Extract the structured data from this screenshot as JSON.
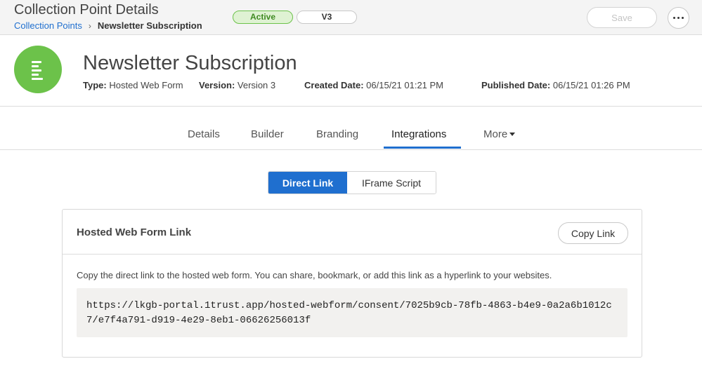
{
  "header": {
    "title": "Collection Point Details",
    "breadcrumb": {
      "link": "Collection Points",
      "current": "Newsletter Subscription"
    },
    "status_badge": "Active",
    "version_badge": "V3",
    "save_label": "Save"
  },
  "colors": {
    "accent": "#1f6fcf",
    "status_green": "#6cc24a",
    "logo_bg": "#6cc24a"
  },
  "collection_point": {
    "icon": "form-list-icon",
    "name": "Newsletter Subscription",
    "type_label": "Type:",
    "type_value": "Hosted Web Form",
    "version_label": "Version:",
    "version_value": "Version 3",
    "created_label": "Created Date:",
    "created_value": "06/15/21 01:21 PM",
    "published_label": "Published Date:",
    "published_value": "06/15/21 01:26 PM"
  },
  "tabs": [
    {
      "label": "Details"
    },
    {
      "label": "Builder"
    },
    {
      "label": "Branding"
    },
    {
      "label": "Integrations",
      "active": true
    },
    {
      "label": "More"
    }
  ],
  "integration_mode": {
    "options": [
      "Direct Link",
      "IFrame Script"
    ],
    "selected": "Direct Link"
  },
  "card": {
    "title": "Hosted Web Form Link",
    "copy_label": "Copy Link",
    "description": "Copy the direct link to the hosted web form. You can share, bookmark, or add this link as a hyperlink to your websites.",
    "link_line1": "https://lkgb-portal.1trust.app/hosted-webform/consent/7025b9cb-78fb-4863-b4e9-0a2a6b1012c",
    "link_line2": "7/e7f4a791-d919-4e29-8eb1-06626256013f"
  }
}
